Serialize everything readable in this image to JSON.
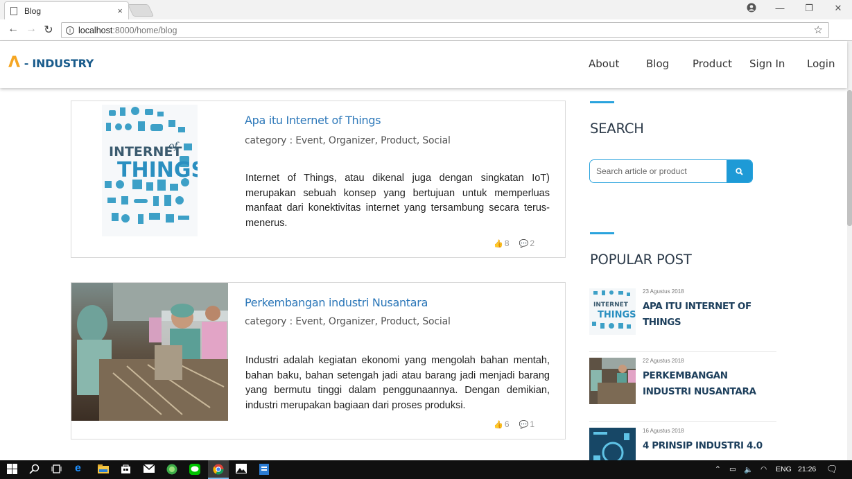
{
  "browser": {
    "tab_title": "Blog",
    "tab_close": "×",
    "url_host": "localhost",
    "url_path": ":8000/home/blog"
  },
  "site": {
    "brand": "- INDUSTRY",
    "brand_logo_letter": "Λ",
    "nav": [
      "About",
      "Blog",
      "Product",
      "Sign In",
      "Login"
    ]
  },
  "posts": [
    {
      "title": "Apa itu Internet of Things",
      "category": "category : Event, Organizer, Product, Social",
      "excerpt": "Internet of Things, atau dikenal juga dengan singkatan IoT) merupakan sebuah konsep yang bertujuan untuk memperluas manfaat dari konektivitas internet yang tersambung secara terus-menerus.",
      "likes": "8",
      "comments": "2",
      "thumb_caption_1": "INTERNET",
      "thumb_caption_2": "of",
      "thumb_caption_3": "THINGS"
    },
    {
      "title": "Perkembangan industri Nusantara",
      "category": "category : Event, Organizer, Product, Social",
      "excerpt": "Industri adalah kegiatan ekonomi yang mengolah bahan mentah, bahan baku, bahan setengah jadi atau barang jadi menjadi barang yang bermutu tinggi dalam penggunaannya. Dengan demikian, industri merupakan bagiaan dari proses produksi.",
      "likes": "6",
      "comments": "1"
    }
  ],
  "sidebar": {
    "search_heading": "SEARCH",
    "search_placeholder": "Search article or product",
    "popular_heading": "POPULAR POST",
    "popular": [
      {
        "date": "23 Agustus 2018",
        "title": "APA ITU INTERNET OF THINGS"
      },
      {
        "date": "22 Agustus 2018",
        "title": "PERKEMBANGAN INDUSTRI NUSANTARA"
      },
      {
        "date": "16 Agustus 2018",
        "title": "4 PRINSIP INDUSTRI 4.0"
      }
    ]
  },
  "taskbar": {
    "language": "ENG",
    "time": "21:26"
  },
  "colors": {
    "brand": "#1a5c8c",
    "accent": "#29a3dd",
    "logo": "#f5a623",
    "link": "#2a76b8"
  }
}
